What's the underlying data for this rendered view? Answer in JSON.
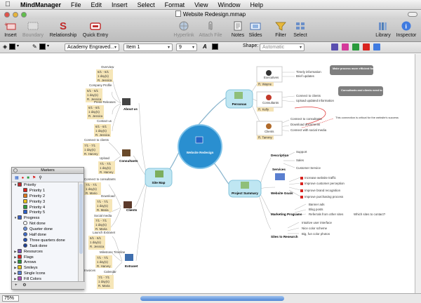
{
  "menubar": {
    "app_name": "MindManager",
    "items": [
      "File",
      "Edit",
      "Insert",
      "Select",
      "Format",
      "View",
      "Window",
      "Help"
    ]
  },
  "window": {
    "title": "Website Redesign.mmap"
  },
  "toolbar": {
    "insert": "Insert",
    "boundary": "Boundary",
    "relationship": "Relationship",
    "quick_entry": "Quick Entry",
    "hyperlink": "Hyperlink",
    "attach_file": "Attach File",
    "notes": "Notes",
    "slides": "Slides",
    "filter": "Filter",
    "select": "Select",
    "library": "Library",
    "inspector": "Inspector"
  },
  "formatbar": {
    "font": "Academy Engraved...",
    "style": "Item 1",
    "size": "9",
    "italic_glyph": "A",
    "shape_label": "Shape:",
    "shape_value": "Automatic"
  },
  "map": {
    "central": "Website Redesign",
    "main_topics": {
      "personas": "Personas",
      "site_map": "Site Map",
      "project_summary": "Project Summary"
    },
    "personas": {
      "executives": "Executives",
      "executives_person": "R. Wayne",
      "executives_notes": [
        "Timely information",
        "Brief updates"
      ],
      "consultants": "Consultants",
      "consultants_person": "R. Kelly",
      "consultants_notes": [
        "Connect to clients",
        "Upload updated information"
      ],
      "clients": "Clients",
      "clients_person": "R. Tammy",
      "clients_notes": [
        "Connect to consultants",
        "Download documents",
        "Connect with social media"
      ],
      "callout1": "Make process more efficient for executives",
      "callout2": "Consultants and clients need to connect",
      "callout3": "This connection is critical for the website's success"
    },
    "summary": {
      "description": "Description",
      "description_items": [
        "Support",
        "Sales",
        "Customer Service"
      ],
      "services": "Services",
      "goals": "Website Goals",
      "goals_items": [
        "Increase website traffic",
        "Improve customer perception",
        "Improve brand recognition",
        "Improve purchasing process"
      ],
      "marketing": "Marketing Programs",
      "marketing_items": [
        "Banner ads",
        "Blog posts",
        "Referrals from other sites",
        "Which sites to contact?"
      ],
      "research": "Sites to Research",
      "research_items": [
        "Intuitive user interface",
        "Nice color scheme",
        "Big, fun color photos"
      ]
    },
    "sitemap": {
      "about_us": "About us",
      "consultants": "Consultants",
      "clients": "Clients",
      "extranet": "Extranet",
      "about_children": [
        "Overview",
        "Company Profile",
        "Press Releases",
        "Contact us"
      ],
      "consultant_children": [
        "Connect to clients",
        "Upload"
      ],
      "client_children": [
        "Connect to consultants",
        "Download",
        "Social media"
      ],
      "extranet_children": [
        "Launch Extranet",
        "Milestone Timeline",
        "Invoices",
        "Calendar"
      ],
      "task_persons": [
        "R. Jessica",
        "R. Harvey",
        "R. Mario",
        "R. Maria"
      ],
      "task_dates": [
        "6/1 - 6/1",
        "1 day(s)",
        "7/1 - 7/1",
        "7/1 - 7/1"
      ]
    }
  },
  "markers": {
    "title": "Markers",
    "groups": [
      {
        "label": "Priority",
        "open": true,
        "color": "#c0282d"
      },
      {
        "label": "Priority 1",
        "indent": 1,
        "color": "#d9231f"
      },
      {
        "label": "Priority 2",
        "indent": 1,
        "color": "#e07b1e"
      },
      {
        "label": "Priority 3",
        "indent": 1,
        "color": "#e7c21e"
      },
      {
        "label": "Priority 4",
        "indent": 1,
        "color": "#2b9b3d"
      },
      {
        "label": "Priority 5",
        "indent": 1,
        "color": "#2a5fc8"
      },
      {
        "label": "Progress",
        "open": true,
        "color": "#3a5fbf"
      },
      {
        "label": "Not done",
        "indent": 1,
        "color": "#ffffff"
      },
      {
        "label": "Quarter done",
        "indent": 1,
        "color": "#6a8fd9"
      },
      {
        "label": "Half done",
        "indent": 1,
        "color": "#3e6dcc"
      },
      {
        "label": "Three quarters done",
        "indent": 1,
        "color": "#2450b0"
      },
      {
        "label": "Task done",
        "indent": 1,
        "color": "#1c3f94"
      },
      {
        "label": "Resources",
        "open": false,
        "color": "#7a55b8"
      },
      {
        "label": "Flags",
        "open": false,
        "color": "#d9231f"
      },
      {
        "label": "Arrows",
        "open": false,
        "color": "#2a8f3d"
      },
      {
        "label": "Smileys",
        "open": false,
        "color": "#e7c21e"
      },
      {
        "label": "Single Icons",
        "open": false,
        "color": "#5a7fd0"
      },
      {
        "label": "Fill Colors",
        "open": false,
        "color": "#b14fc0"
      }
    ]
  },
  "status": {
    "zoom": "75%"
  },
  "colors": {
    "accent": "#2a8fd0",
    "topic_fill": "#bfe6f2",
    "callout": "#7f7f7f"
  }
}
